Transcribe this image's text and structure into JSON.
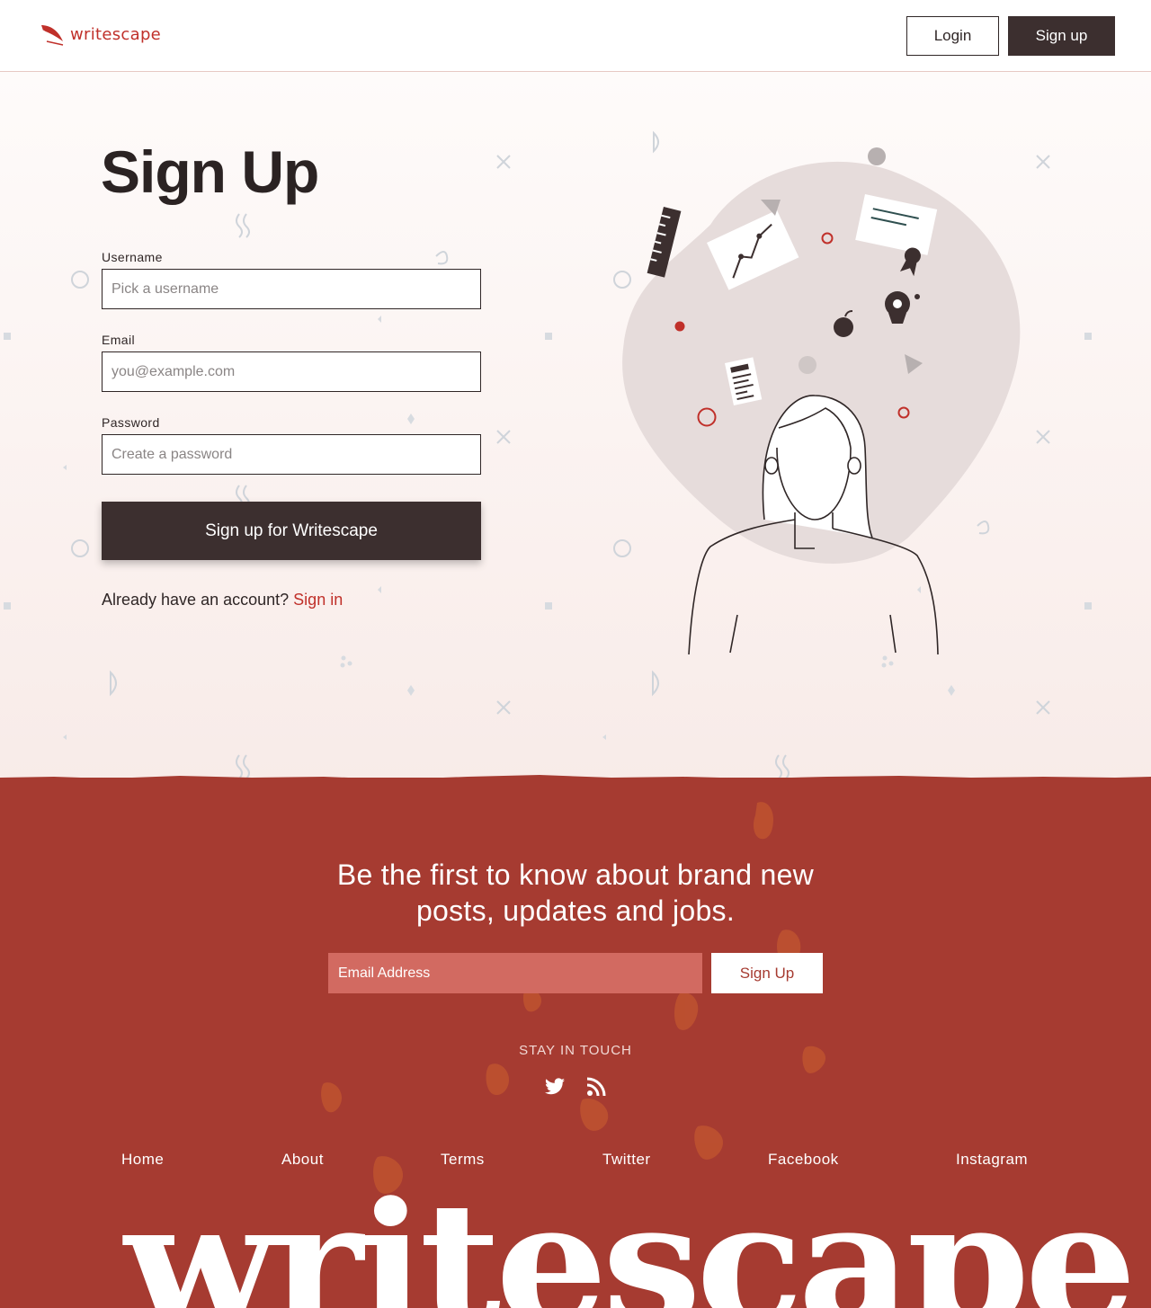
{
  "header": {
    "logo_text": "writescape",
    "login_label": "Login",
    "signup_label": "Sign up"
  },
  "signup": {
    "title": "Sign Up",
    "username": {
      "label": "Username",
      "placeholder": "Pick a username"
    },
    "email": {
      "label": "Email",
      "placeholder": "you@example.com"
    },
    "password": {
      "label": "Password",
      "placeholder": "Create a password"
    },
    "submit_label": "Sign up for Writescape",
    "already_text": "Already have an account?",
    "signin_link": "Sign in"
  },
  "newsletter": {
    "title": "Be the first to know about brand new posts, updates and jobs.",
    "email_placeholder": "Email Address",
    "button_label": "Sign Up",
    "stay_in_touch": "STAY IN TOUCH",
    "social_icons": [
      "twitter-icon",
      "rss-icon"
    ]
  },
  "footer_nav": [
    "Home",
    "About",
    "Terms",
    "Twitter",
    "Facebook",
    "Instagram"
  ],
  "footer_wordmark": "writescape",
  "colors": {
    "brand_red": "#c0302a",
    "dark": "#3c2f2f",
    "footer_bg": "#a63b31",
    "newsletter_input": "#d26a61"
  }
}
